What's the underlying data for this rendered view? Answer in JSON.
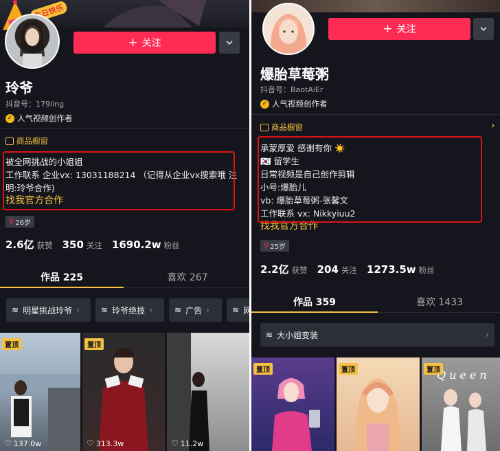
{
  "left": {
    "banner_text": "生日快乐",
    "follow_label": "关注",
    "name": "玲爷",
    "douyin_id": "抖音号：179ling",
    "creator_label": "人气视频创作者",
    "shop_label": "商品橱窗",
    "bio": [
      "被全网挑战的小姐姐",
      "工作联系 企业vx: 13031188214 （记得从企业vx搜索哦 注",
      "明:玲爷合作)"
    ],
    "bio_link": "找我官方合作",
    "age": "26岁",
    "stats": [
      {
        "value": "2.6亿",
        "label": "获赞"
      },
      {
        "value": "350",
        "label": "关注"
      },
      {
        "value": "1690.2w",
        "label": "粉丝"
      }
    ],
    "tabs": [
      {
        "label": "作品 225"
      },
      {
        "label": "喜欢 267"
      }
    ],
    "chips": [
      {
        "label": "明星挑战玲爷"
      },
      {
        "label": "玲爷绝技"
      },
      {
        "label": "广告"
      },
      {
        "label": "网"
      }
    ],
    "thumbs": [
      {
        "pin": "置顶",
        "likes": "137.0w"
      },
      {
        "pin": "置顶",
        "likes": "313.3w"
      },
      {
        "pin": "",
        "likes": "11.2w"
      }
    ]
  },
  "right": {
    "follow_label": "关注",
    "name": "爆胎草莓粥",
    "douyin_id": "抖音号：BaotAiEr",
    "creator_label": "人气视频创作者",
    "shop_label": "商品橱窗",
    "bio": [
      "承蒙厚爱 感谢有你 ☀️",
      "🇰🇷 留学生",
      "日常视频是自己创作剪辑",
      "小号:爆胎儿",
      "vb: 爆胎草莓粥-张馨文",
      "工作联系 vx: Nikkyiuu2"
    ],
    "bio_link": "找我官方合作",
    "age": "25岁",
    "stats": [
      {
        "value": "2.2亿",
        "label": "获赞"
      },
      {
        "value": "204",
        "label": "关注"
      },
      {
        "value": "1273.5w",
        "label": "粉丝"
      }
    ],
    "tabs": [
      {
        "label": "作品 359"
      },
      {
        "label": "喜欢 1433"
      }
    ],
    "chips": [
      {
        "label": "大小姐变装"
      }
    ],
    "thumbs": [
      {
        "pin": "置顶"
      },
      {
        "pin": "置顶"
      },
      {
        "pin": "置顶",
        "overlay": "Queen"
      }
    ]
  },
  "colors": {
    "accent": "#fe2c55",
    "gold": "#f6c142",
    "highlight": "#e01313",
    "bg": "#15151d"
  },
  "icons": [
    "plus-icon",
    "chevron-down-icon",
    "creator-badge-icon",
    "shop-icon",
    "chevron-right-icon",
    "female-icon",
    "collection-icon",
    "heart-icon"
  ]
}
